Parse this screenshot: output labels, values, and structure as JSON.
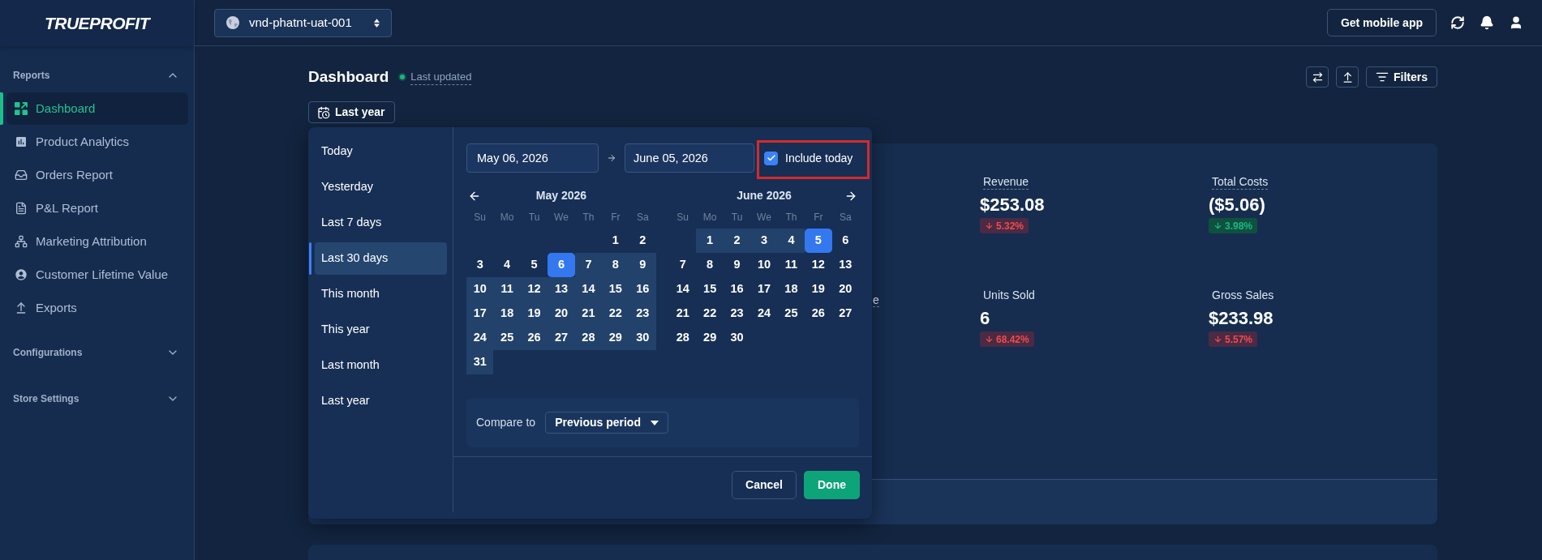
{
  "sidebar": {
    "logo": "TRUEPROFIT",
    "sections": [
      {
        "title": "Reports",
        "expanded": true,
        "items": [
          {
            "label": "Dashboard",
            "selected": true
          },
          {
            "label": "Product Analytics",
            "selected": false
          },
          {
            "label": "Orders Report",
            "selected": false
          },
          {
            "label": "P&L Report",
            "selected": false
          },
          {
            "label": "Marketing Attribution",
            "selected": false
          },
          {
            "label": "Customer Lifetime Value",
            "selected": false
          },
          {
            "label": "Exports",
            "selected": false
          }
        ]
      },
      {
        "title": "Configurations",
        "expanded": false
      },
      {
        "title": "Store Settings",
        "expanded": false
      }
    ]
  },
  "top_bar": {
    "store": "vnd-phatnt-uat-001",
    "mobile_button": "Get mobile app"
  },
  "header": {
    "title": "Dashboard",
    "status": "Last updated",
    "filters_button": "Filters",
    "date_button": "Last year"
  },
  "date_picker": {
    "presets": [
      {
        "label": "Today",
        "selected": false
      },
      {
        "label": "Yesterday",
        "selected": false
      },
      {
        "label": "Last 7 days",
        "selected": false
      },
      {
        "label": "Last 30 days",
        "selected": true
      },
      {
        "label": "This month",
        "selected": false
      },
      {
        "label": "This year",
        "selected": false
      },
      {
        "label": "Last month",
        "selected": false
      },
      {
        "label": "Last year",
        "selected": false
      }
    ],
    "start_date": "May 06, 2026",
    "end_date": "June 05, 2026",
    "include_today": {
      "label": "Include today",
      "checked": true
    },
    "months": [
      {
        "title": "May 2026",
        "weekdays": [
          "Su",
          "Mo",
          "Tu",
          "We",
          "Th",
          "Fr",
          "Sa"
        ],
        "weeks": [
          [
            {
              "d": "1",
              "selected": false,
              "in_range": false
            },
            {
              "d": "2",
              "selected": false,
              "in_range": false
            }
          ],
          [
            {
              "d": "3",
              "selected": false,
              "in_range": false
            },
            {
              "d": "4",
              "selected": false,
              "in_range": false
            },
            {
              "d": "5",
              "selected": false,
              "in_range": false
            },
            {
              "d": "6",
              "selected": true,
              "in_range": false
            },
            {
              "d": "7",
              "selected": false,
              "in_range": true
            },
            {
              "d": "8",
              "selected": false,
              "in_range": true
            },
            {
              "d": "9",
              "selected": false,
              "in_range": true
            }
          ],
          [
            {
              "d": "10",
              "selected": false,
              "in_range": true
            },
            {
              "d": "11",
              "selected": false,
              "in_range": true
            },
            {
              "d": "12",
              "selected": false,
              "in_range": true
            },
            {
              "d": "13",
              "selected": false,
              "in_range": true
            },
            {
              "d": "14",
              "selected": false,
              "in_range": true
            },
            {
              "d": "15",
              "selected": false,
              "in_range": true
            },
            {
              "d": "16",
              "selected": false,
              "in_range": true
            }
          ],
          [
            {
              "d": "17",
              "selected": false,
              "in_range": true
            },
            {
              "d": "18",
              "selected": false,
              "in_range": true
            },
            {
              "d": "19",
              "selected": false,
              "in_range": true
            },
            {
              "d": "20",
              "selected": false,
              "in_range": true
            },
            {
              "d": "21",
              "selected": false,
              "in_range": true
            },
            {
              "d": "22",
              "selected": false,
              "in_range": true
            },
            {
              "d": "23",
              "selected": false,
              "in_range": true
            }
          ],
          [
            {
              "d": "24",
              "selected": false,
              "in_range": true
            },
            {
              "d": "25",
              "selected": false,
              "in_range": true
            },
            {
              "d": "26",
              "selected": false,
              "in_range": true
            },
            {
              "d": "27",
              "selected": false,
              "in_range": true
            },
            {
              "d": "28",
              "selected": false,
              "in_range": true
            },
            {
              "d": "29",
              "selected": false,
              "in_range": true
            },
            {
              "d": "30",
              "selected": false,
              "in_range": true
            }
          ],
          [
            {
              "d": "31",
              "selected": false,
              "in_range": true
            }
          ]
        ]
      },
      {
        "title": "June 2026",
        "weekdays": [
          "Su",
          "Mo",
          "Tu",
          "We",
          "Th",
          "Fr",
          "Sa"
        ],
        "weeks": [
          [
            {
              "d": "1",
              "selected": false,
              "in_range": true
            },
            {
              "d": "2",
              "selected": false,
              "in_range": true
            },
            {
              "d": "3",
              "selected": false,
              "in_range": true
            },
            {
              "d": "4",
              "selected": false,
              "in_range": true
            },
            {
              "d": "5",
              "selected": true,
              "in_range": false
            },
            {
              "d": "6",
              "selected": false,
              "in_range": false
            }
          ],
          [
            {
              "d": "7",
              "selected": false,
              "in_range": false
            },
            {
              "d": "8",
              "selected": false,
              "in_range": false
            },
            {
              "d": "9",
              "selected": false,
              "in_range": false
            },
            {
              "d": "10",
              "selected": false,
              "in_range": false
            },
            {
              "d": "11",
              "selected": false,
              "in_range": false
            },
            {
              "d": "12",
              "selected": false,
              "in_range": false
            },
            {
              "d": "13",
              "selected": false,
              "in_range": false
            }
          ],
          [
            {
              "d": "14",
              "selected": false,
              "in_range": false
            },
            {
              "d": "15",
              "selected": false,
              "in_range": false
            },
            {
              "d": "16",
              "selected": false,
              "in_range": false
            },
            {
              "d": "17",
              "selected": false,
              "in_range": false
            },
            {
              "d": "18",
              "selected": false,
              "in_range": false
            },
            {
              "d": "19",
              "selected": false,
              "in_range": false
            },
            {
              "d": "20",
              "selected": false,
              "in_range": false
            }
          ],
          [
            {
              "d": "21",
              "selected": false,
              "in_range": false
            },
            {
              "d": "22",
              "selected": false,
              "in_range": false
            },
            {
              "d": "23",
              "selected": false,
              "in_range": false
            },
            {
              "d": "24",
              "selected": false,
              "in_range": false
            },
            {
              "d": "25",
              "selected": false,
              "in_range": false
            },
            {
              "d": "26",
              "selected": false,
              "in_range": false
            },
            {
              "d": "27",
              "selected": false,
              "in_range": false
            }
          ],
          [
            {
              "d": "28",
              "selected": false,
              "in_range": false
            },
            {
              "d": "29",
              "selected": false,
              "in_range": false
            },
            {
              "d": "30",
              "selected": false,
              "in_range": false
            }
          ]
        ]
      }
    ],
    "compare": {
      "label": "Compare to",
      "value": "Previous period"
    },
    "buttons": [
      {
        "label": "Cancel",
        "kind": "secondary"
      },
      {
        "label": "Done",
        "kind": "primary"
      }
    ]
  },
  "metrics": {
    "fragment": "e",
    "items": [
      {
        "label": "Revenue",
        "underlined": true,
        "value": "$253.08",
        "change": "5.32%",
        "falling": true,
        "kind": "negative"
      },
      {
        "label": "Total Costs",
        "underlined": true,
        "value": "($5.06)",
        "change": "3.98%",
        "falling": true,
        "kind": "positive"
      },
      {
        "label": "Units Sold",
        "underlined": false,
        "value": "6",
        "change": "68.42%",
        "falling": true,
        "kind": "negative"
      },
      {
        "label": "Gross Sales",
        "underlined": false,
        "value": "$233.98",
        "change": "5.57%",
        "falling": true,
        "kind": "negative"
      }
    ]
  }
}
